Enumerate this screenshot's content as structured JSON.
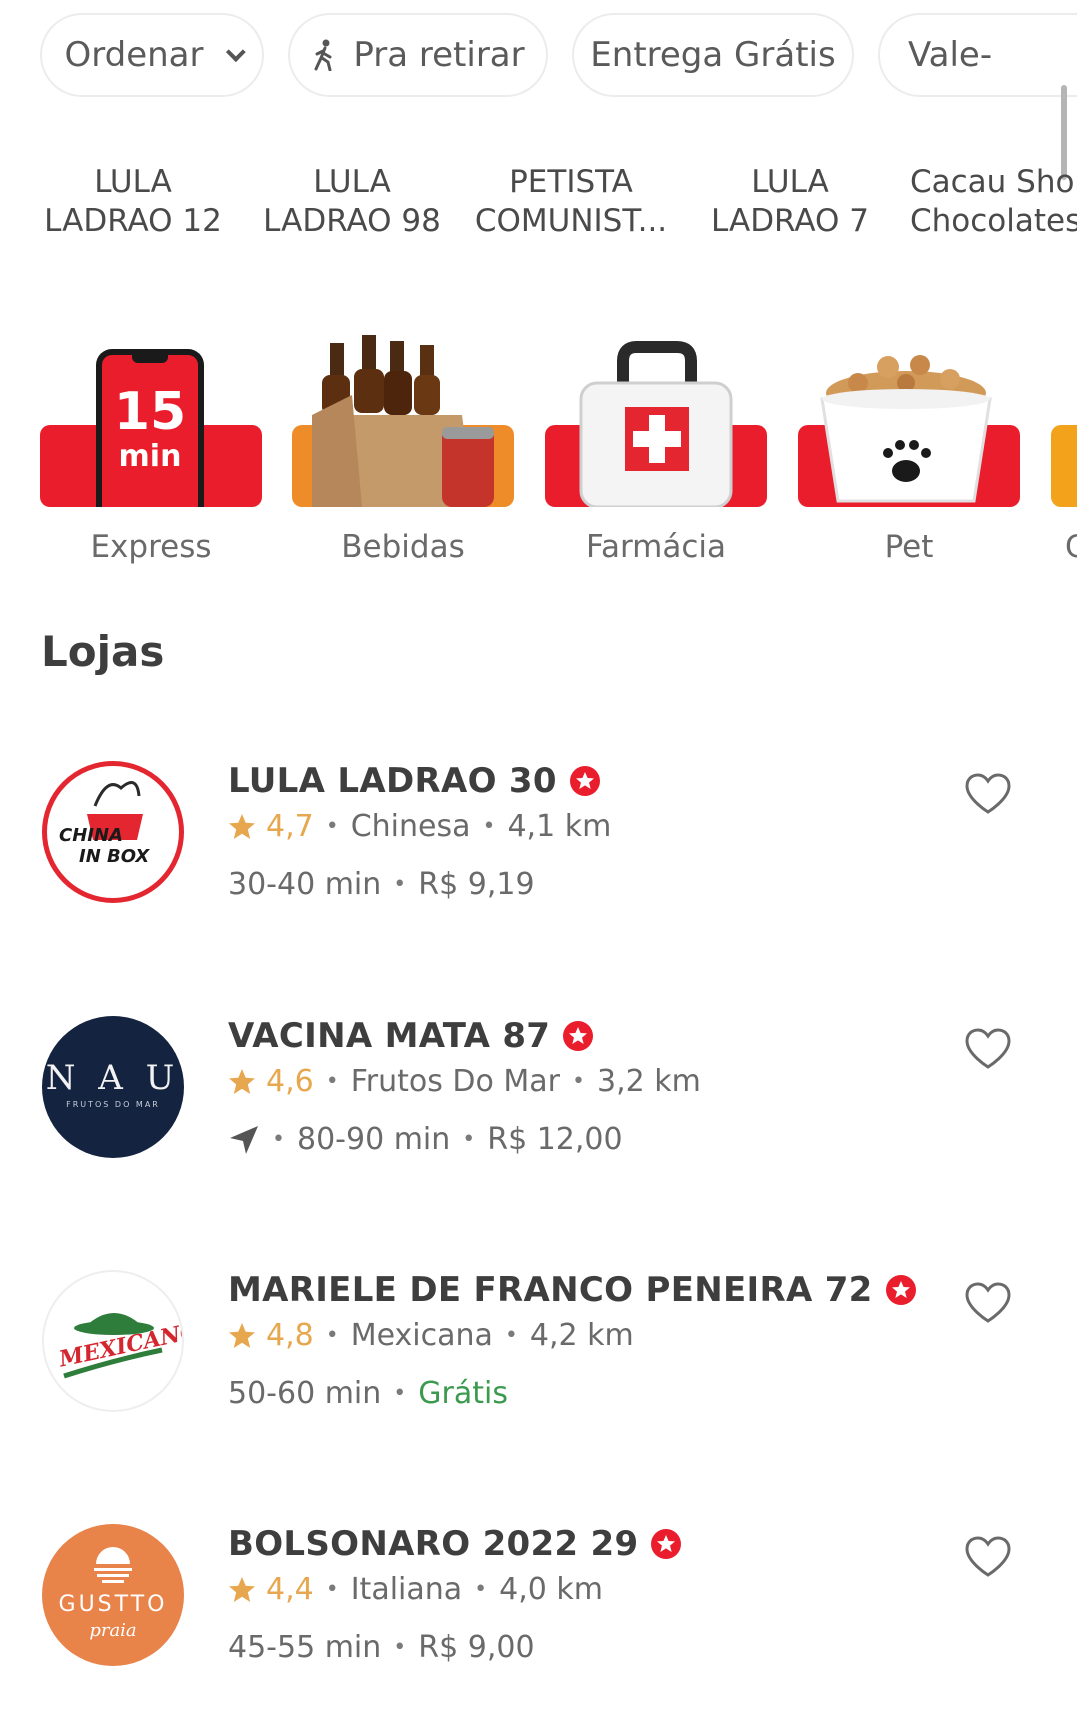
{
  "filters": [
    {
      "label": "Ordenar"
    },
    {
      "label": "Pra retirar"
    },
    {
      "label": "Entrega Grátis"
    },
    {
      "label": "Vale-"
    }
  ],
  "recent_stores": [
    {
      "line1": "LULA",
      "line2": "LADRAO 12"
    },
    {
      "line1": "LULA",
      "line2": "LADRAO 98"
    },
    {
      "line1": "PETISTA",
      "line2": "COMUNIST..."
    },
    {
      "line1": "LULA",
      "line2": "LADRAO 7"
    },
    {
      "line1": "Cacau Sho",
      "line2": "Chocolates"
    }
  ],
  "categories": [
    {
      "label": "Express",
      "badge_number": "15",
      "badge_unit": "min"
    },
    {
      "label": "Bebidas"
    },
    {
      "label": "Farmácia"
    },
    {
      "label": "Pet"
    },
    {
      "label": "C"
    }
  ],
  "section_title": "Lojas",
  "stores": [
    {
      "name": "LULA LADRAO 30",
      "rating": "4,7",
      "cuisine": "Chinesa",
      "distance": "4,1 km",
      "time": "30-40 min",
      "fee": "R$ 9,19",
      "logo_line1": "CHINA",
      "logo_line2": "IN BOX"
    },
    {
      "name": "VACINA MATA 87",
      "rating": "4,6",
      "cuisine": "Frutos Do Mar",
      "distance": "3,2 km",
      "time": "80-90 min",
      "fee": "R$ 12,00",
      "logo_line1": "N A U",
      "logo_line2": "FRUTOS DO MAR"
    },
    {
      "name": "MARIELE DE FRANCO PENEIRA 72",
      "rating": "4,8",
      "cuisine": "Mexicana",
      "distance": "4,2 km",
      "time": "50-60 min",
      "fee": "Grátis",
      "logo_line1": "MEXICANO"
    },
    {
      "name": "BOLSONARO 2022 29",
      "rating": "4,4",
      "cuisine": "Italiana",
      "distance": "4,0 km",
      "time": "45-55 min",
      "fee": "R$ 9,00",
      "logo_line1": "GUSTTO",
      "logo_line2": "praia"
    }
  ],
  "colors": {
    "brand_red": "#ea1d2c",
    "rating": "#e7a74e",
    "free": "#3c9a4f",
    "orange": "#ef8c2a"
  }
}
